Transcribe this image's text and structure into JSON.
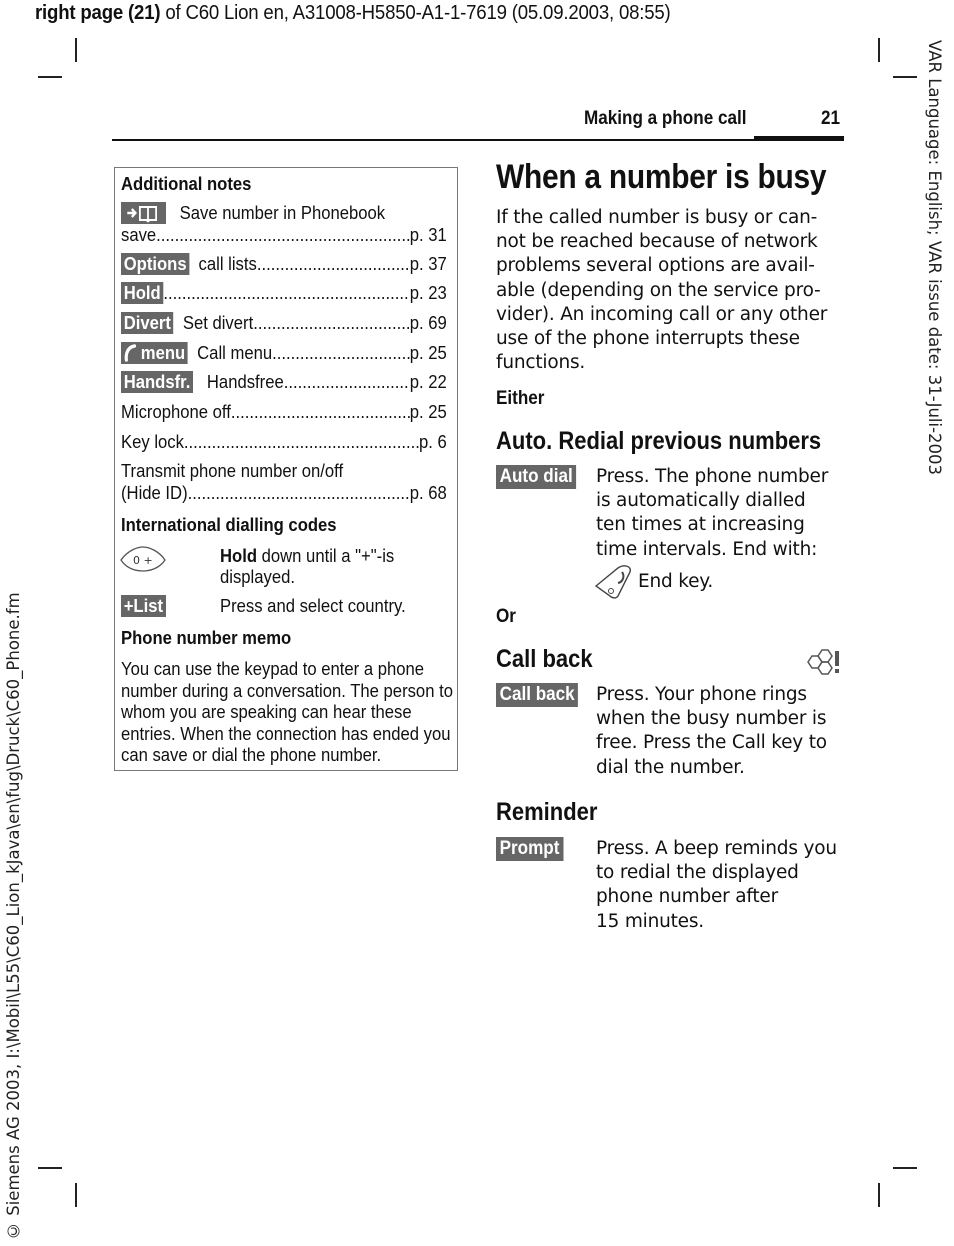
{
  "print_header": {
    "bold_part": "right page (21)",
    "rest": " of C60 Lion en, A31008-H5850-A1-1-7619 (05.09.2003, 08:55)"
  },
  "side_right": "VAR Language: English; VAR issue date: 31-Juli-2003",
  "side_left": "© Siemens AG 2003, I:\\Mobil\\L55\\C60_Lion_kJava\\en\\fug\\Druck\\C60_Phone.fm",
  "running_head": {
    "title": "Making a phone call",
    "page": "21"
  },
  "notes": {
    "heading": "Additional notes",
    "phonebook": {
      "icon": "arrow-book-icon",
      "text": "Save number in Phonebook",
      "cont": "save ",
      "page": "p. 31"
    },
    "items": [
      {
        "key": "Options",
        "label": "call lists ",
        "page": "p. 37"
      },
      {
        "key": "Hold",
        "label": "",
        "page": "p. 23"
      },
      {
        "key": "Divert",
        "label": "Set divert ",
        "page": "p. 69"
      },
      {
        "key": "menu",
        "key_icon": "phone-handset-icon",
        "label": "Call menu",
        "page": "p. 25"
      },
      {
        "key": "Handsfr.",
        "label": "Handsfree ",
        "page": "p. 22"
      }
    ],
    "plain_items": [
      {
        "label": "Microphone off ",
        "page": "p. 25"
      },
      {
        "label": "Key lock",
        "page": "p. 6"
      }
    ],
    "transmit": {
      "line1": "Transmit phone number on/off",
      "line2": "(Hide ID)",
      "page": "p. 68"
    },
    "intl": {
      "heading": "International dialling codes",
      "zero_key": "0 +",
      "hold_bold": "Hold",
      "hold_rest": " down until a \"+\"-is",
      "hold_line2": "displayed.",
      "list_key": "+List",
      "list_text": "Press and select country."
    },
    "memo": {
      "heading": "Phone number memo",
      "text": "You can use the keypad to enter a phone number during a conversation. The person to whom you are speaking can hear these entries. When the connection has ended you can save or dial the phone number."
    }
  },
  "main": {
    "title": "When a number is busy",
    "intro_lines": [
      "If the called number is busy or can-",
      "not be reached because of network",
      "problems several options are avail-",
      "able (depending on the service pro-",
      "vider). An incoming call or any other",
      "use of the phone interrupts these",
      "functions."
    ],
    "either": "Either",
    "or": "Or",
    "sections": [
      {
        "heading": "Auto. Redial previous numbers",
        "key": "Auto dial",
        "lines": [
          "Press. The phone number",
          "is automatically dialled",
          "ten times at increasing",
          "time intervals. End with:"
        ],
        "end_key_text": "End key."
      },
      {
        "heading": "Call back",
        "network_icon": "network-service-icon",
        "key": "Call back",
        "lines": [
          "Press. Your phone rings",
          "when the busy number is",
          "free. Press the Call key to",
          "dial the number."
        ]
      },
      {
        "heading": "Reminder",
        "key": "Prompt",
        "lines": [
          "Press. A beep reminds you",
          "to redial the displayed",
          "phone number after",
          "15 minutes."
        ]
      }
    ]
  }
}
